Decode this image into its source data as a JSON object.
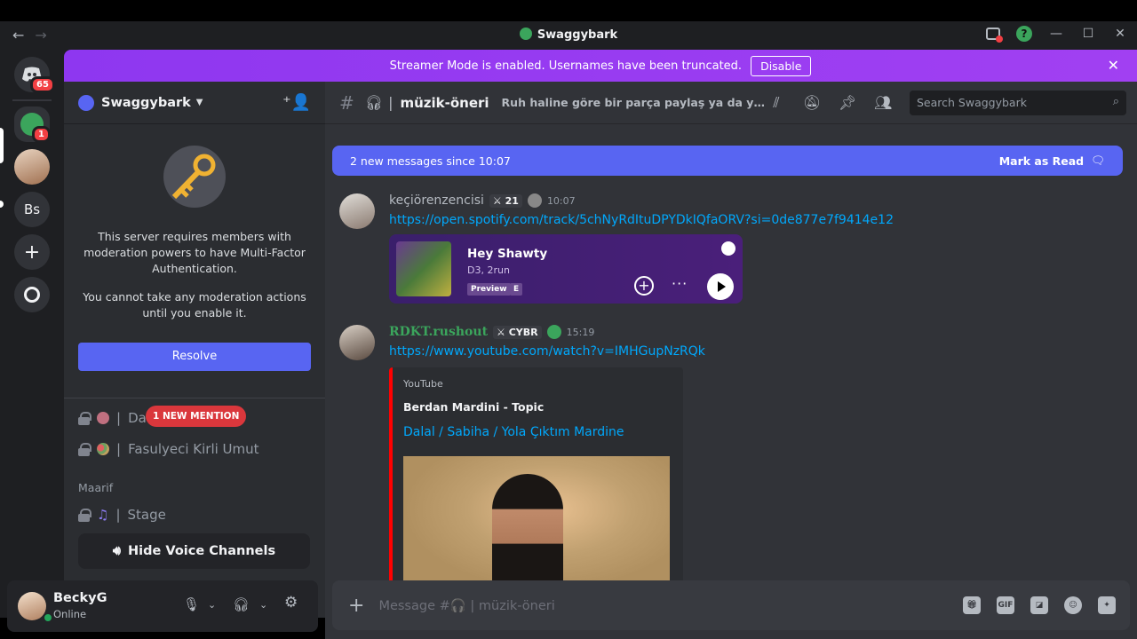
{
  "titlebar": {
    "back": "←",
    "forward": "→",
    "title": "Swaggybark"
  },
  "rail": {
    "home_badge": "65",
    "server_badge": "1",
    "bs_label": "Bs"
  },
  "banner": {
    "text": "Streamer Mode is enabled. Usernames have been truncated.",
    "button": "Disable"
  },
  "server": {
    "name": "Swaggybark"
  },
  "mfa": {
    "line1": "This server requires members with moderation powers to have Multi-Factor Authentication.",
    "line2": "You cannot take any moderation actions until you enable it.",
    "resolve": "Resolve"
  },
  "channels": [
    {
      "name": "Da",
      "badge": "1 NEW MENTION"
    },
    {
      "name": "Fasulyeci Kirli Umut"
    }
  ],
  "category": "Maarif",
  "stage": "Stage",
  "hide_voice": "Hide Voice Channels",
  "user": {
    "name": "BeckyG",
    "status": "Online"
  },
  "channel": {
    "name": "müzik-öneri",
    "topic": "Ruh haline göre bir parça paylaş ya da yeni bir ..."
  },
  "search": {
    "placeholder": "Search Swaggybark"
  },
  "newbar": {
    "text": "2 new messages since 10:07",
    "mark": "Mark as Read"
  },
  "messages": [
    {
      "author": "keçiörenzencisi",
      "tag": "21",
      "time": "10:07",
      "link": "https://open.spotify.com/track/5chNyRdItuDPYDkIQfaORV?si=0de877e7f9414e12",
      "embed": {
        "title": "Hey Shawty",
        "artist": "D3, 2run",
        "preview": "Preview",
        "explicit": "E"
      }
    },
    {
      "author": "RDKT.rushout",
      "tag": "CYBR",
      "time": "15:19",
      "link": "https://www.youtube.com/watch?v=IMHGupNzRQk",
      "embed": {
        "provider": "YouTube",
        "author": "Berdan Mardini - Topic",
        "title": "Dalal / Sabiha / Yola Çıktım Mardine"
      }
    }
  ],
  "composer": {
    "placeholder": "Message #🎧 | müzik-öneri",
    "gif": "GIF"
  }
}
